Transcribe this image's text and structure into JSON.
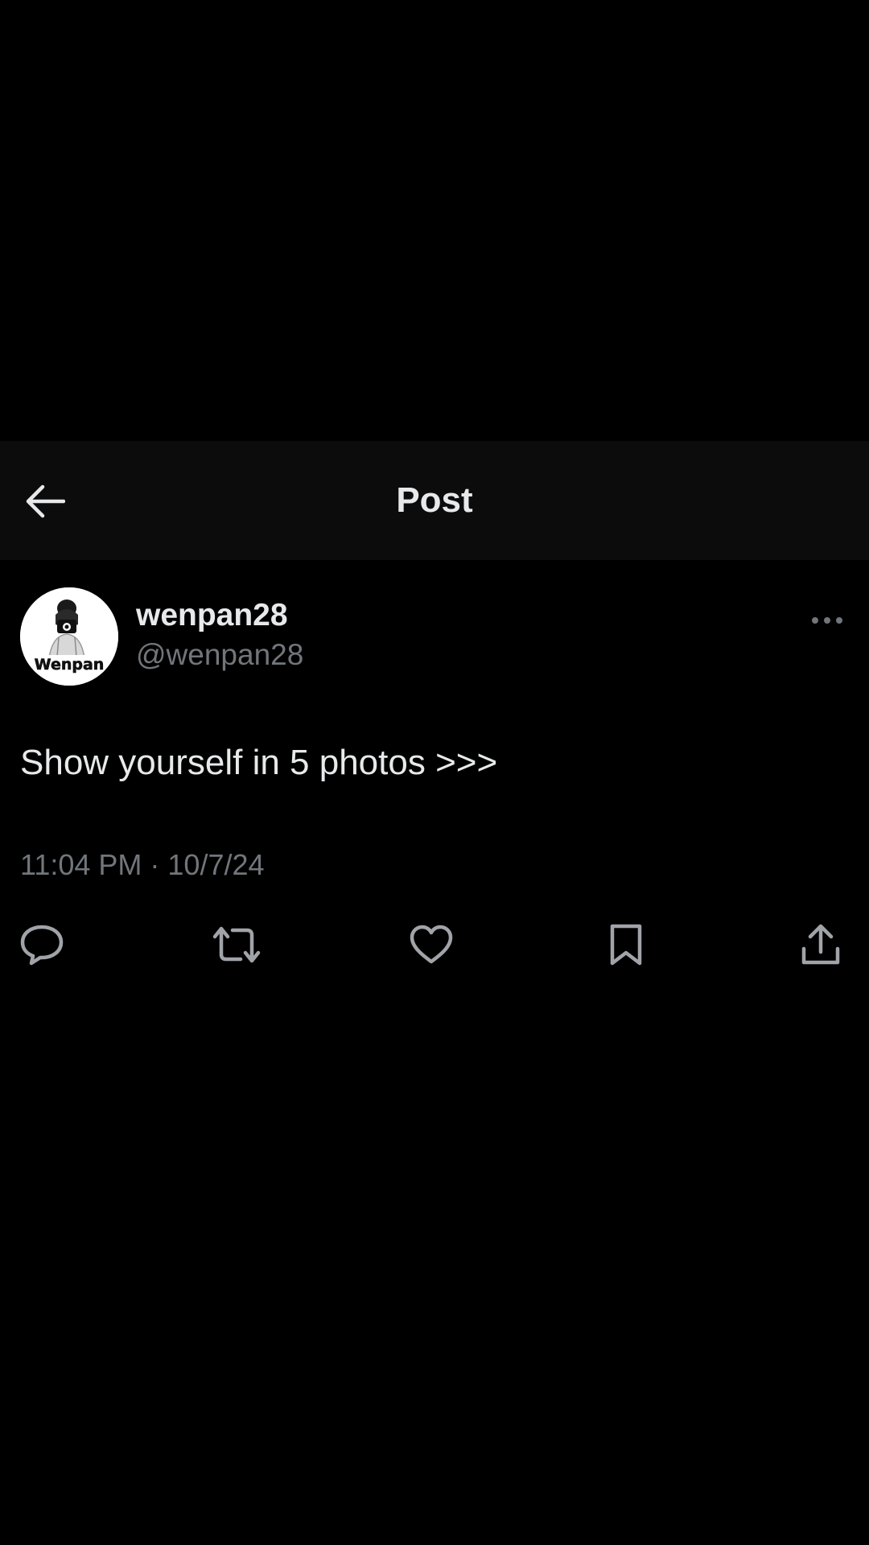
{
  "header": {
    "title": "Post",
    "back_icon": "arrow-left-icon"
  },
  "post": {
    "author": {
      "display_name": "wenpan28",
      "handle": "@wenpan28",
      "avatar_text": "Wenpan"
    },
    "more_icon": "more-horizontal-icon",
    "text": "Show yourself in 5 photos >>>",
    "timestamp": "11:04 PM · 10/7/24",
    "actions": [
      {
        "name": "reply",
        "icon": "reply-icon"
      },
      {
        "name": "repost",
        "icon": "repost-icon"
      },
      {
        "name": "like",
        "icon": "heart-icon"
      },
      {
        "name": "bookmark",
        "icon": "bookmark-icon"
      },
      {
        "name": "share",
        "icon": "share-icon"
      }
    ]
  },
  "colors": {
    "background": "#000000",
    "header_background": "#0c0c0c",
    "primary_text": "#e7e9ea",
    "secondary_text": "#71767b",
    "icon": "#a0a4a8"
  }
}
